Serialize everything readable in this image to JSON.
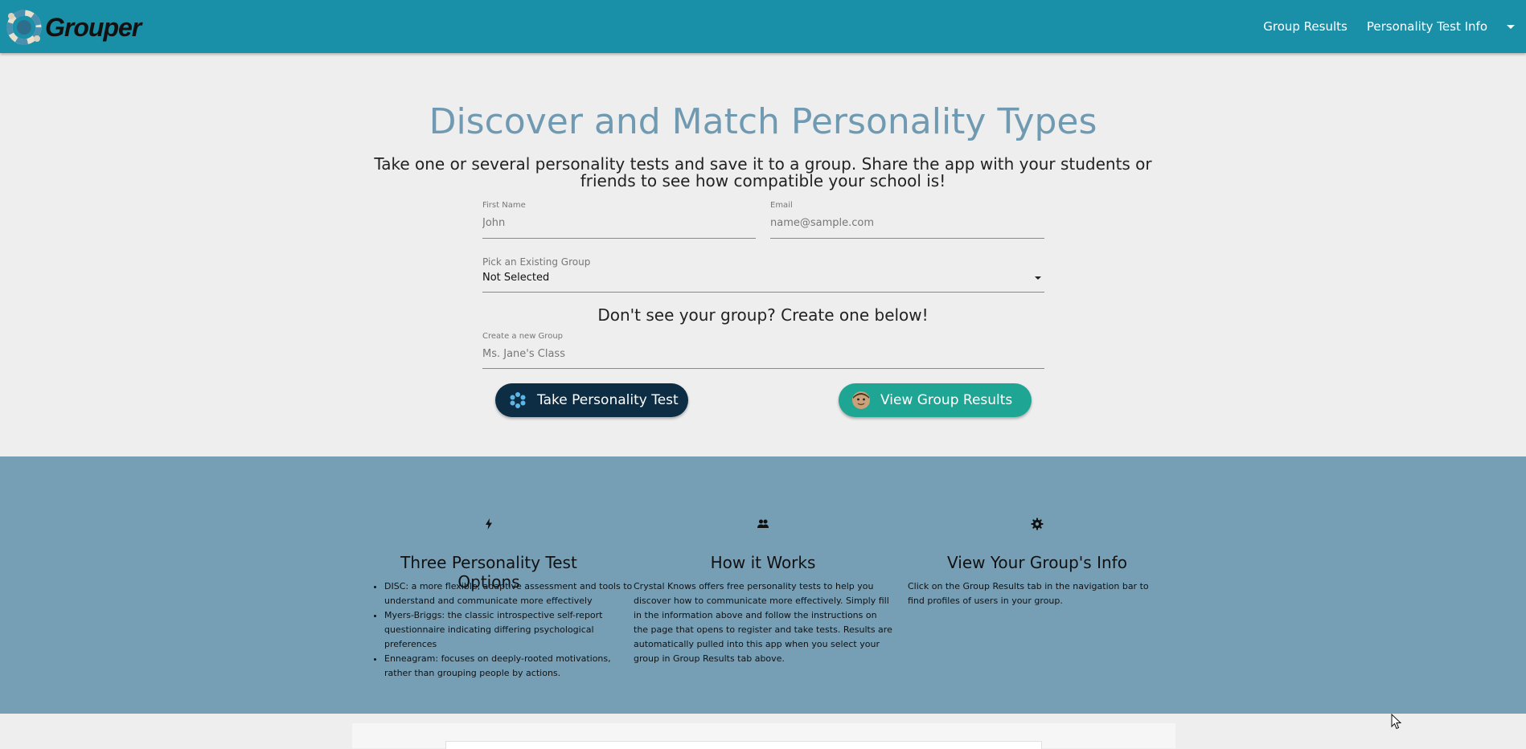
{
  "brand": {
    "name": "Grouper"
  },
  "nav": {
    "group_results": "Group Results",
    "personality_info": "Personality Test Info"
  },
  "hero": {
    "title": "Discover and Match Personality Types",
    "subtitle": "Take one or several personality tests and save it to a group. Share the app with your students or friends to see how compatible your school is!"
  },
  "form": {
    "first_name": {
      "label": "First Name",
      "placeholder": "John"
    },
    "email": {
      "label": "Email",
      "placeholder": "name@sample.com"
    },
    "group_select": {
      "label": "Pick an Existing Group",
      "value": "Not Selected"
    },
    "create_heading": "Don't see your group? Create one below!",
    "new_group": {
      "label": "Create a new Group",
      "placeholder": "Ms. Jane's Class"
    },
    "take_test_label": "Take Personality Test",
    "view_results_label": "View Group Results"
  },
  "features": [
    {
      "icon": "bolt-icon",
      "title": "Three Personality Test Options",
      "items": [
        "DISC: a more flexible, adaptive assessment and tools to understand and communicate more effectively",
        "Myers-Briggs: the classic introspective self-report questionnaire indicating differing psychological preferences",
        "Enneagram: focuses on deeply-rooted motivations, rather than grouping people by actions."
      ]
    },
    {
      "icon": "people-icon",
      "title": "How it Works",
      "text": "Crystal Knows offers free personality tests to help you discover how to communicate more effectively. Simply fill in the information above and follow the instructions on the page that opens to register and take tests. Results are automatically pulled into this app when you select your group in Group Results tab above."
    },
    {
      "icon": "gear-icon",
      "title": "View Your Group's Info",
      "text": "Click on the Group Results tab in the navigation bar to find profiles of users in your group."
    }
  ],
  "colors": {
    "navbar": "#1a8fa8",
    "hero_title": "#6f9ab1",
    "features_bg": "#769fb6",
    "btn_dark": "#0d2d45",
    "btn_teal": "#1ea594"
  }
}
